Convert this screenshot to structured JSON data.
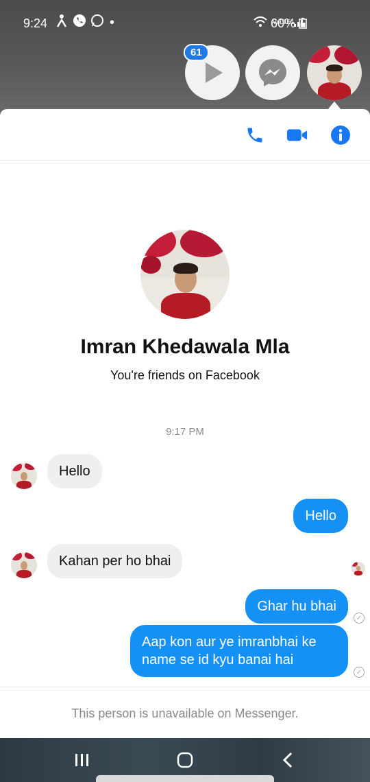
{
  "status_bar": {
    "time": "9:24",
    "battery": "60%",
    "network_label": "VoLTE1",
    "icons": [
      "person-walk-icon",
      "phone-call-icon",
      "whatsapp-icon",
      "dot-icon",
      "wifi-icon",
      "signal-icon",
      "battery-icon"
    ]
  },
  "chat_heads": {
    "badge_count": "61",
    "items": [
      "video-play-icon",
      "messenger-icon",
      "contact-avatar"
    ]
  },
  "header": {
    "actions": [
      "phone-icon",
      "video-camera-icon",
      "info-icon"
    ]
  },
  "profile": {
    "name": "Imran Khedawala Mla",
    "subtitle": "You're friends on Facebook"
  },
  "conversation": {
    "timestamp": "9:17 PM",
    "messages": [
      {
        "direction": "in",
        "text": "Hello"
      },
      {
        "direction": "out",
        "text": "Hello"
      },
      {
        "direction": "in",
        "text": "Kahan per ho bhai"
      },
      {
        "direction": "out",
        "text": "Ghar hu bhai"
      },
      {
        "direction": "out",
        "text": "Aap kon aur ye imranbhai ke name se id kyu banai hai"
      }
    ]
  },
  "footer": {
    "notice": "This person is unavailable on Messenger."
  },
  "colors": {
    "messenger_blue": "#1591f5",
    "incoming_bubble": "#efefef",
    "icon_blue": "#1877f2",
    "badge_blue": "#2179e6"
  }
}
